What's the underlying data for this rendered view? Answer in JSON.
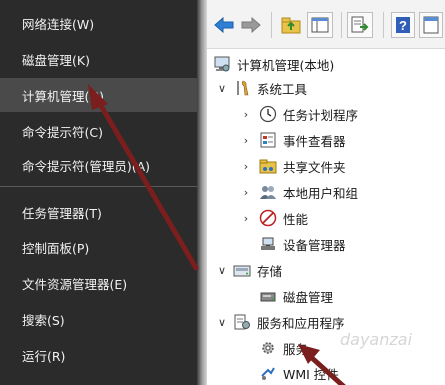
{
  "context_menu": {
    "items": [
      {
        "label": "网络连接(W)"
      },
      {
        "label": "磁盘管理(K)"
      },
      {
        "label": "计算机管理(G)",
        "highlighted": true
      },
      {
        "label": "命令提示符(C)"
      },
      {
        "label": "命令提示符(管理员)(A)"
      },
      {
        "label": "任务管理器(T)"
      },
      {
        "label": "控制面板(P)"
      },
      {
        "label": "文件资源管理器(E)"
      },
      {
        "label": "搜索(S)"
      },
      {
        "label": "运行(R)"
      }
    ]
  },
  "toolbar": {
    "buttons": [
      "back-arrow-icon",
      "forward-arrow-icon",
      "up-folder-icon",
      "console-tree-icon",
      "export-list-icon",
      "help-icon",
      "properties-icon"
    ]
  },
  "tree": {
    "root": "计算机管理(本地)",
    "system_tools": {
      "label": "系统工具",
      "children": [
        "任务计划程序",
        "事件查看器",
        "共享文件夹",
        "本地用户和组",
        "性能",
        "设备管理器"
      ]
    },
    "storage": {
      "label": "存储",
      "children": [
        "磁盘管理"
      ]
    },
    "services_apps": {
      "label": "服务和应用程序",
      "children": [
        "服务",
        "WMI 控件"
      ]
    }
  },
  "watermark": "dayanzai",
  "colors": {
    "menu_bg": "#2b2b2b",
    "menu_highlight": "#4a4a4a",
    "arrow": "#7a1e1e"
  }
}
